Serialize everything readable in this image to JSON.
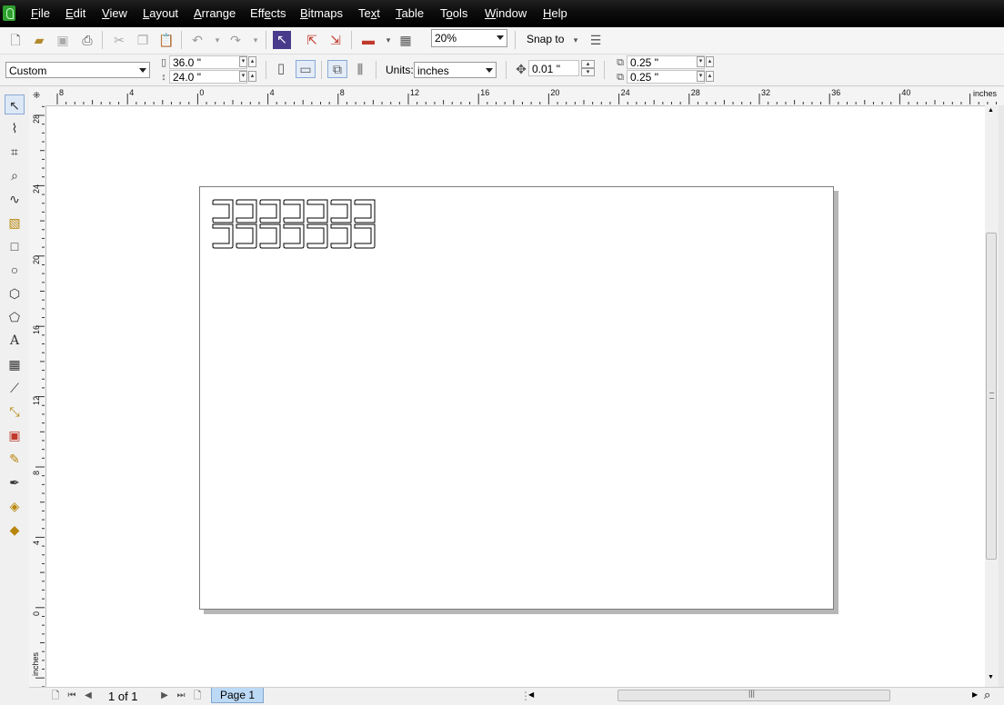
{
  "menu": {
    "items": [
      {
        "pre": "",
        "ul": "F",
        "post": "ile"
      },
      {
        "pre": "",
        "ul": "E",
        "post": "dit"
      },
      {
        "pre": "",
        "ul": "V",
        "post": "iew"
      },
      {
        "pre": "",
        "ul": "L",
        "post": "ayout"
      },
      {
        "pre": "",
        "ul": "A",
        "post": "rrange"
      },
      {
        "pre": "Eff",
        "ul": "e",
        "post": "cts"
      },
      {
        "pre": "",
        "ul": "B",
        "post": "itmaps"
      },
      {
        "pre": "Te",
        "ul": "x",
        "post": "t"
      },
      {
        "pre": "",
        "ul": "T",
        "post": "able"
      },
      {
        "pre": "T",
        "ul": "o",
        "post": "ols"
      },
      {
        "pre": "",
        "ul": "W",
        "post": "indow"
      },
      {
        "pre": "",
        "ul": "H",
        "post": "elp"
      }
    ]
  },
  "toolbar": {
    "zoom": "20%",
    "snap_to": "Snap to"
  },
  "property_bar": {
    "paper_type": "Custom",
    "width": "36.0 \"",
    "height": "24.0 \"",
    "units_label": "Units:",
    "units_value": "inches",
    "nudge": "0.01 \"",
    "dup_x": "0.25 \"",
    "dup_y": "0.25 \""
  },
  "rulers": {
    "unit": "inches",
    "h_ticks": [
      "8",
      "4",
      "0",
      "4",
      "8",
      "12",
      "16",
      "20",
      "24",
      "28",
      "32",
      "36",
      "40"
    ],
    "v_ticks": [
      "28",
      "24",
      "20",
      "16",
      "12",
      "8",
      "4",
      "0"
    ],
    "v_unit": "inches"
  },
  "status": {
    "page_counter": "1 of 1",
    "page_tab": "Page 1"
  },
  "colors": {
    "menubar": "#000000",
    "page_tab": "#bcd9f5"
  }
}
